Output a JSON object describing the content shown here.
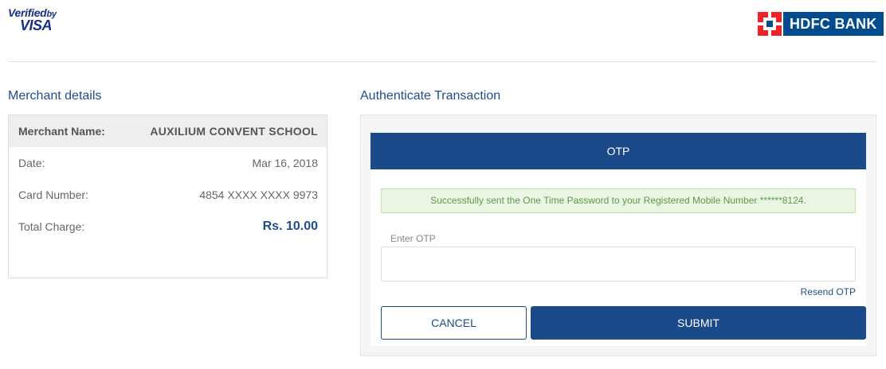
{
  "header": {
    "visa_line1": "Verified",
    "visa_by": "by",
    "visa_line2": "VISA",
    "bank_name": "HDFC BANK",
    "brand_colors": {
      "hdfc_red": "#ed232a",
      "hdfc_blue": "#004c8f",
      "visa_blue": "#1a2f86"
    }
  },
  "merchant": {
    "title": "Merchant details",
    "name_label": "Merchant Name:",
    "name_value": "AUXILIUM CONVENT SCHOOL",
    "date_label": "Date:",
    "date_value": "Mar 16, 2018",
    "card_label": "Card Number:",
    "card_value": "4854 XXXX XXXX 9973",
    "charge_label": "Total Charge:",
    "charge_value": "Rs. 10.00"
  },
  "auth": {
    "title": "Authenticate Transaction",
    "otp_header": "OTP",
    "success_message": "Successfully sent the One Time Password to your Registered Mobile Number ******8124.",
    "otp_label": "Enter OTP",
    "otp_value": "",
    "resend_label": "Resend OTP",
    "cancel_label": "CANCEL",
    "submit_label": "SUBMIT",
    "accent_color": "#1a4a8a",
    "success_color": "#5c9a49"
  }
}
